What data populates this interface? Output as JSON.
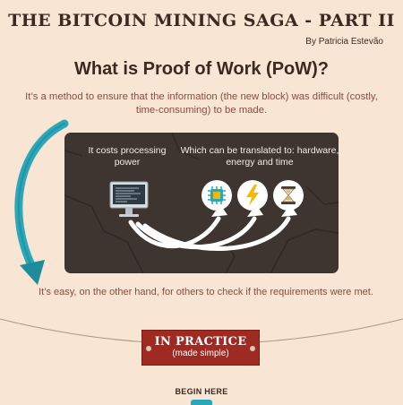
{
  "header": {
    "title": "THE BITCOIN MINING SAGA - PART II",
    "byline": "By Patricia Estevão"
  },
  "intro": {
    "question": "What is Proof of Work (PoW)?",
    "definition": "It’s a method to ensure that the information (the new block) was difficult (costly, time-consuming) to be made."
  },
  "panel": {
    "left_caption": "It costs processing power",
    "right_caption": "Which can be translated to: hardware, energy and time",
    "icons": [
      "computer-icon",
      "chip-icon",
      "lightning-icon",
      "hourglass-icon"
    ]
  },
  "verification": {
    "text": "It’s easy, on the other hand, for others to check if the requirements were met."
  },
  "practice": {
    "title": "IN PRACTICE",
    "subtitle": "(made simple)"
  },
  "cta": {
    "begin_label": "BEGIN HERE"
  },
  "colors": {
    "background": "#f8e5d3",
    "panel": "#3e3530",
    "accent_teal": "#2aa7b8",
    "text_brown": "#8e4a3c",
    "practice_red": "#9e2a22",
    "bolt_yellow": "#f5b800"
  }
}
